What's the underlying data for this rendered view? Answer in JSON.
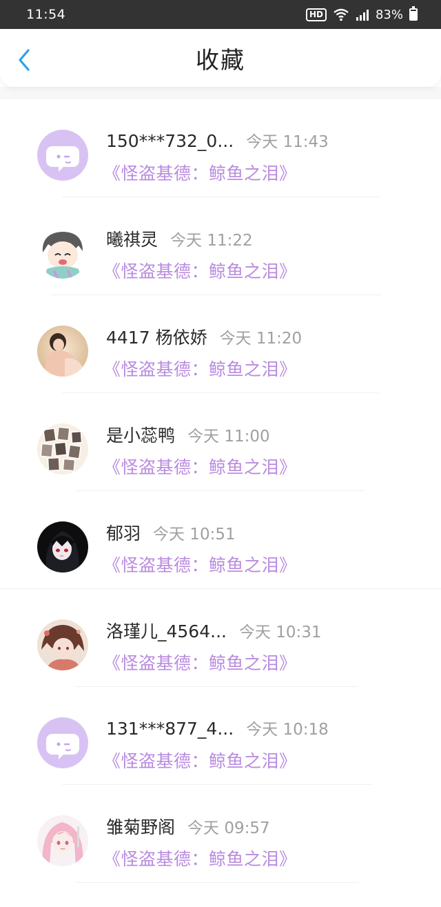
{
  "status_bar": {
    "time": "11:54",
    "hd": "HD",
    "battery": "83%"
  },
  "header": {
    "title": "收藏"
  },
  "favorites": [
    {
      "name": "150***732_0...",
      "time": "今天 11:43",
      "book": "《怪盗基德：鲸鱼之泪》",
      "avatar": "default-avatar"
    },
    {
      "name": "曦祺灵",
      "time": "今天 11:22",
      "book": "《怪盗基德：鲸鱼之泪》",
      "avatar": "cartoon-boy-avatar"
    },
    {
      "name": "4417 杨依娇",
      "time": "今天 11:20",
      "book": "《怪盗基德：鲸鱼之泪》",
      "avatar": "photo-avatar"
    },
    {
      "name": "是小蕊鸭",
      "time": "今天 11:00",
      "book": "《怪盗基德：鲸鱼之泪》",
      "avatar": "collage-avatar"
    },
    {
      "name": "郁羽",
      "time": "今天 10:51",
      "book": "《怪盗基德：鲸鱼之泪》",
      "avatar": "anime-dark-avatar"
    },
    {
      "name": "洛瑾儿_4564...",
      "time": "今天 10:31",
      "book": "《怪盗基德：鲸鱼之泪》",
      "avatar": "anime-warm-avatar"
    },
    {
      "name": "131***877_4...",
      "time": "今天 10:18",
      "book": "《怪盗基德：鲸鱼之泪》",
      "avatar": "default-avatar"
    },
    {
      "name": "雏菊野阁",
      "time": "今天 09:57",
      "book": "《怪盗基德：鲸鱼之泪》",
      "avatar": "anime-pink-avatar"
    }
  ],
  "colors": {
    "accent": "#b98be0",
    "back": "#2aa2e6",
    "default_avatar_bg": "#d8c2f3"
  }
}
